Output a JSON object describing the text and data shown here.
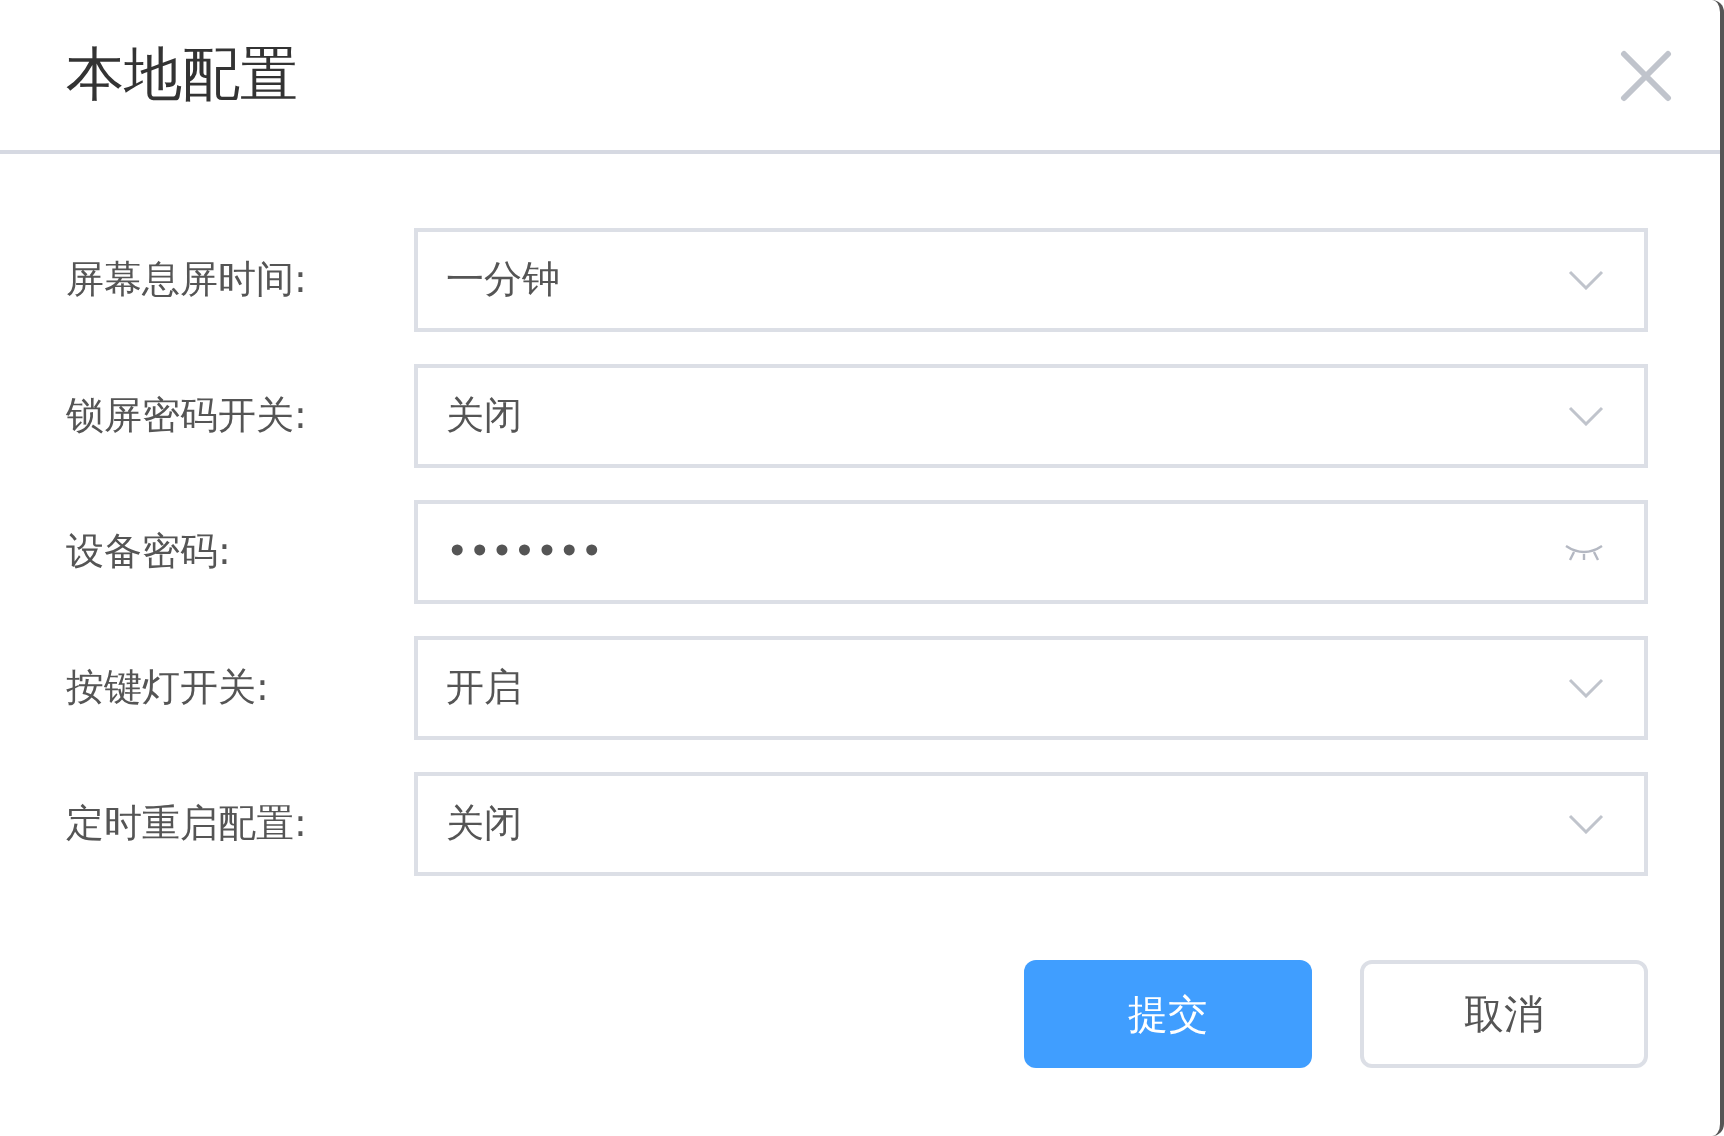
{
  "dialog": {
    "title": "本地配置"
  },
  "fields": [
    {
      "label": "屏幕息屏时间:",
      "kind": "select",
      "value": "一分钟"
    },
    {
      "label": "锁屏密码开关:",
      "kind": "select",
      "value": "关闭"
    },
    {
      "label": "设备密码:",
      "kind": "password",
      "value": "•••••••"
    },
    {
      "label": "按键灯开关:",
      "kind": "select",
      "value": "开启"
    },
    {
      "label": "定时重启配置:",
      "kind": "select",
      "value": "关闭"
    }
  ],
  "buttons": [
    {
      "label": "提交",
      "kind": "primary"
    },
    {
      "label": "取消",
      "kind": "default"
    }
  ]
}
